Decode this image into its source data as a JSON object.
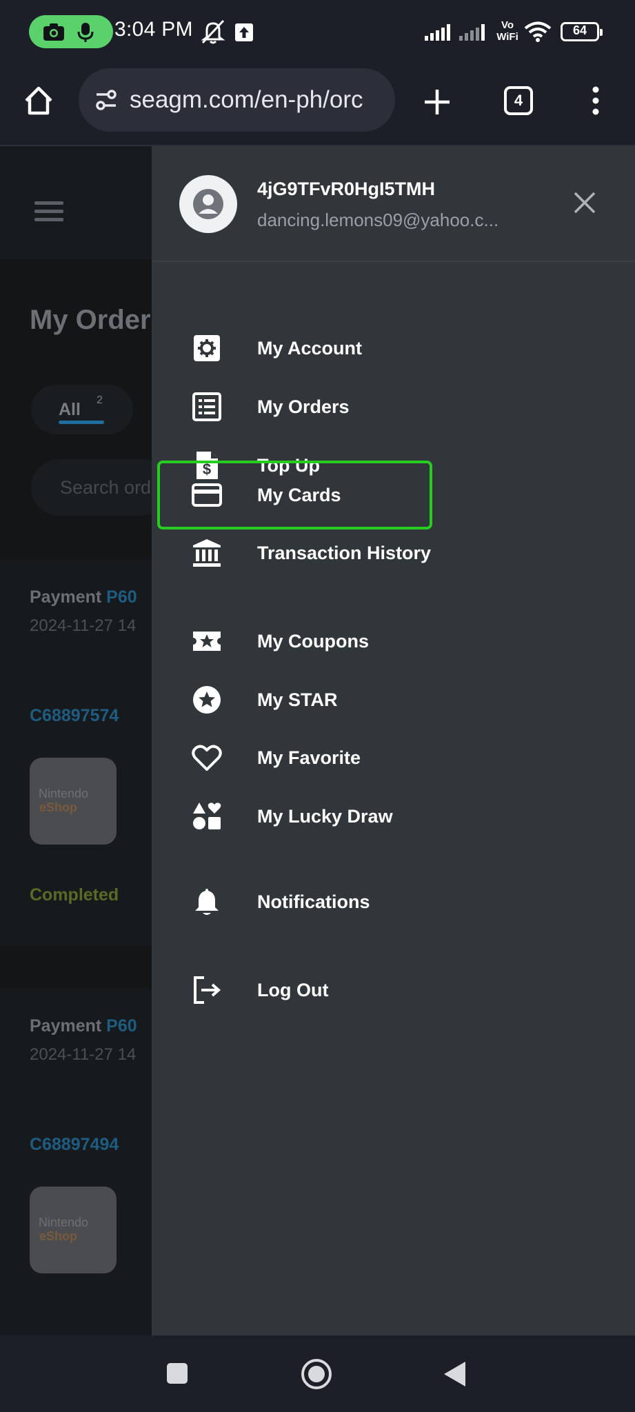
{
  "status_bar": {
    "time": "3:04 PM",
    "battery": "64",
    "network_label": "Vo WiFi"
  },
  "browser": {
    "url": "seagm.com/en-ph/orc",
    "tab_count": "4"
  },
  "background_page": {
    "title": "My Order",
    "tab_all_label": "All",
    "tab_all_count": "2",
    "search_placeholder": "Search ord",
    "orders": [
      {
        "payment_label": "Payment",
        "payment_id": "P60",
        "date": "2024-11-27 14",
        "order_id": "C68897574",
        "thumb_line1": "Nintendo",
        "thumb_line2": "eShop",
        "status": "Completed"
      },
      {
        "payment_label": "Payment",
        "payment_id": "P60",
        "date": "2024-11-27 14",
        "order_id": "C68897494",
        "thumb_line1": "Nintendo",
        "thumb_line2": "eShop"
      }
    ]
  },
  "drawer": {
    "username": "4jG9TFvR0HgI5TMH",
    "email": "dancing.lemons09@yahoo.c...",
    "items": [
      {
        "label": "My Account",
        "icon": "gear-icon"
      },
      {
        "label": "My Orders",
        "icon": "list-icon"
      },
      {
        "label": "Top Up",
        "icon": "dollar-file-icon"
      },
      {
        "label": "My Cards",
        "icon": "credit-card-icon",
        "highlighted": true
      },
      {
        "label": "Transaction History",
        "icon": "bank-icon"
      },
      {
        "label": "My Coupons",
        "icon": "ticket-star-icon"
      },
      {
        "label": "My STAR",
        "icon": "star-circle-icon"
      },
      {
        "label": "My Favorite",
        "icon": "heart-icon"
      },
      {
        "label": "My Lucky Draw",
        "icon": "shapes-icon"
      },
      {
        "label": "Notifications",
        "icon": "bell-icon"
      },
      {
        "label": "Log Out",
        "icon": "logout-icon"
      }
    ]
  },
  "colors": {
    "highlight": "#26cf1f",
    "drawer_bg": "#31363a",
    "recording_pill": "#5ad16a"
  }
}
